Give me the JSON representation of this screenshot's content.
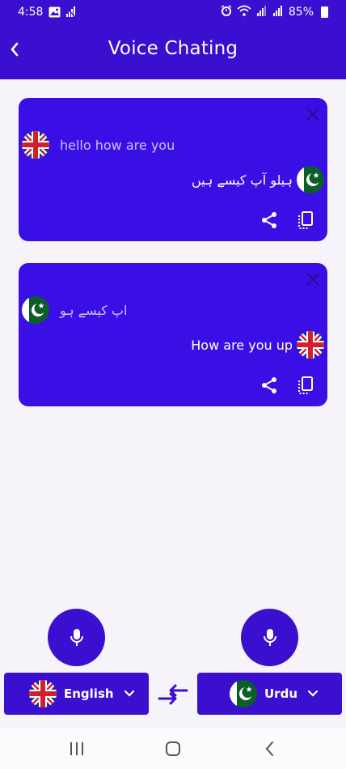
{
  "status_bar": {
    "time": "4:58",
    "battery": "85%",
    "icons_left": [
      "image-icon",
      "signal-off-icon"
    ],
    "icons_right": [
      "alarm-icon",
      "wifi-icon",
      "signal-icon",
      "signal-icon"
    ]
  },
  "header": {
    "title": "Voice Chating",
    "back_icon": "chevron-left-icon"
  },
  "colors": {
    "primary": "#3a0fd0",
    "card": "#3a0fe5",
    "background": "#f6f3fb",
    "source_text": "#c9c2ff"
  },
  "conversations": [
    {
      "source_text": "hello how are you",
      "source_lang_flag": "uk-flag-icon",
      "translated_text": "ہیلو آپ کیسے ہیں",
      "target_lang_flag": "pakistan-flag-icon"
    },
    {
      "source_text": "اپ کیسے ہو",
      "source_lang_flag": "pakistan-flag-icon",
      "translated_text": "How are you up",
      "target_lang_flag": "uk-flag-icon"
    }
  ],
  "languages": {
    "left": {
      "label": "English",
      "flag": "uk-flag-icon"
    },
    "right": {
      "label": "Urdu",
      "flag": "pakistan-flag-icon"
    }
  }
}
